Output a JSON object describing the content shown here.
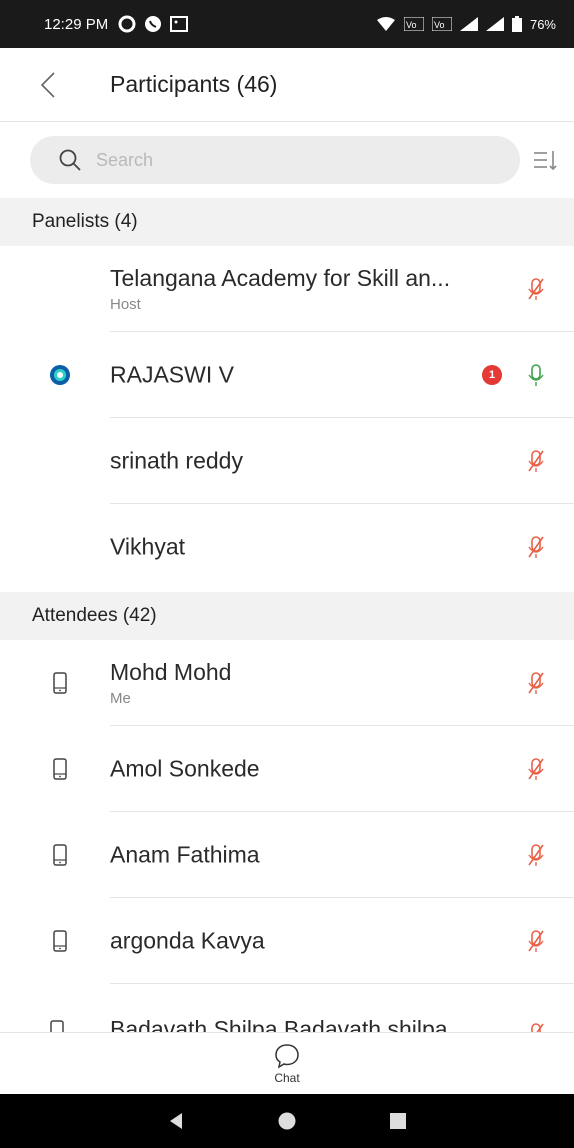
{
  "status_bar": {
    "time": "12:29 PM",
    "battery": "76%",
    "icons": [
      "o-icon",
      "whatsapp-icon",
      "gallery-icon",
      "wifi-icon",
      "volte-icon",
      "volte-icon",
      "signal-icon",
      "signal-icon",
      "battery-icon"
    ]
  },
  "header": {
    "title": "Participants (46)",
    "back_icon": "chevron-left-icon"
  },
  "search": {
    "placeholder": "Search",
    "sort_icon": "sort-icon"
  },
  "panelists": {
    "title": "Panelists (4)",
    "items": [
      {
        "name": "Telangana Academy for Skill an...",
        "subtitle": "Host",
        "mic": "muted"
      },
      {
        "name": "RAJASWI V",
        "subtitle": "",
        "mic": "active",
        "badge": "1",
        "lead": "webex-icon"
      },
      {
        "name": "srinath reddy",
        "subtitle": "",
        "mic": "muted"
      },
      {
        "name": "Vikhyat",
        "subtitle": "",
        "mic": "muted"
      }
    ]
  },
  "attendees": {
    "title": "Attendees (42)",
    "items": [
      {
        "name": "Mohd Mohd",
        "subtitle": "Me",
        "mic": "muted",
        "lead": "phone-icon"
      },
      {
        "name": "Amol Sonkede",
        "subtitle": "",
        "mic": "muted",
        "lead": "phone-icon"
      },
      {
        "name": "Anam Fathima",
        "subtitle": "",
        "mic": "muted",
        "lead": "phone-icon"
      },
      {
        "name": "argonda Kavya",
        "subtitle": "",
        "mic": "muted",
        "lead": "phone-icon"
      },
      {
        "name": "Badavath Shilpa Badavath shilpa",
        "subtitle": "",
        "mic": "muted",
        "lead": "phone-icon"
      }
    ]
  },
  "bottom": {
    "chat_label": "Chat"
  },
  "colors": {
    "muted_mic": "#e8624a",
    "active_mic": "#3fa34d",
    "badge": "#e53935",
    "section_bg": "#f2f2f2"
  }
}
